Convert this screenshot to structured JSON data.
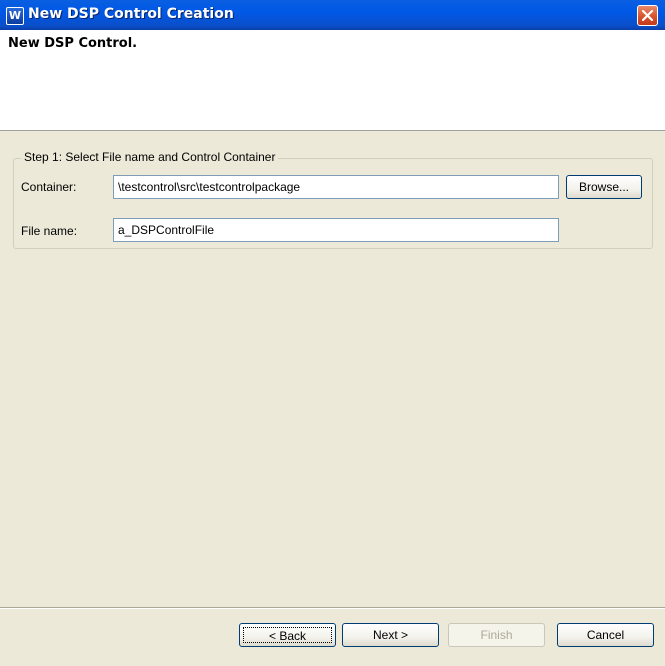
{
  "window": {
    "title": "New DSP Control Creation",
    "app_icon_glyph": "W"
  },
  "header": {
    "title": "New DSP Control."
  },
  "step": {
    "legend": "Step 1: Select File name and Control Container",
    "container_label": "Container:",
    "container_value": "\\testcontrol\\src\\testcontrolpackage",
    "browse_label": "Browse...",
    "filename_label": "File name:",
    "filename_value": "a_DSPControlFile"
  },
  "buttons": {
    "back": "< Back",
    "next": "Next >",
    "finish": "Finish",
    "cancel": "Cancel"
  },
  "colors": {
    "titlebar": "#0058e6",
    "close": "#d8532c",
    "dialog_bg": "#ece9d8"
  }
}
